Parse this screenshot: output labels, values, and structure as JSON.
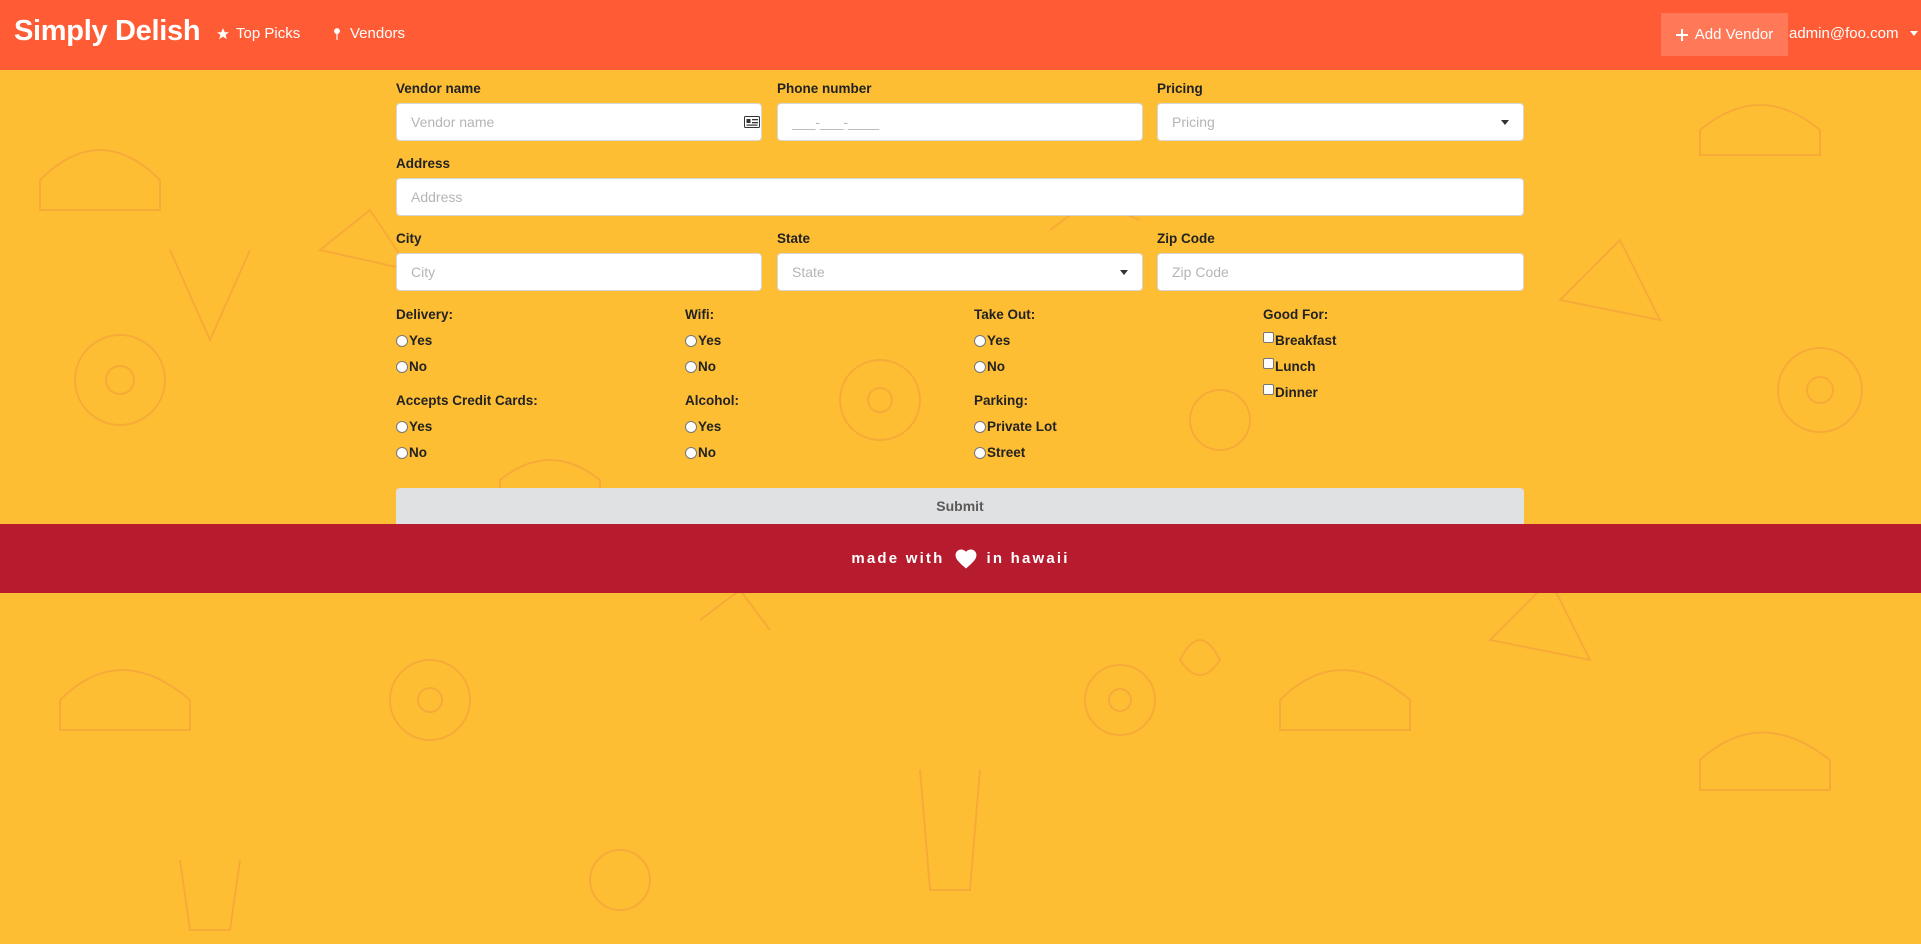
{
  "nav": {
    "brand": "Simply Delish",
    "items": [
      {
        "label": "Top Picks",
        "icon": "star-icon"
      },
      {
        "label": "Vendors",
        "icon": "pin-icon"
      }
    ],
    "add_vendor_label": "Add Vendor",
    "user_email": "admin@foo.com"
  },
  "form": {
    "vendor_name": {
      "label": "Vendor name",
      "placeholder": "Vendor name"
    },
    "phone": {
      "label": "Phone number",
      "placeholder": "___-___-____"
    },
    "pricing": {
      "label": "Pricing",
      "placeholder": "Pricing"
    },
    "address": {
      "label": "Address",
      "placeholder": "Address"
    },
    "city": {
      "label": "City",
      "placeholder": "City"
    },
    "state": {
      "label": "State",
      "placeholder": "State"
    },
    "zip": {
      "label": "Zip Code",
      "placeholder": "Zip Code"
    },
    "delivery": {
      "label": "Delivery:",
      "options": [
        "Yes",
        "No"
      ]
    },
    "wifi": {
      "label": "Wifi:",
      "options": [
        "Yes",
        "No"
      ]
    },
    "takeout": {
      "label": "Take Out:",
      "options": [
        "Yes",
        "No"
      ]
    },
    "good_for": {
      "label": "Good For:",
      "options": [
        "Breakfast",
        "Lunch",
        "Dinner"
      ]
    },
    "credit_cards": {
      "label": "Accepts Credit Cards:",
      "options": [
        "Yes",
        "No"
      ]
    },
    "alcohol": {
      "label": "Alcohol:",
      "options": [
        "Yes",
        "No"
      ]
    },
    "parking": {
      "label": "Parking:",
      "options": [
        "Private Lot",
        "Street"
      ]
    },
    "submit_label": "Submit"
  },
  "footer": {
    "text_before": "made with",
    "text_after": "in hawaii",
    "icon": "heart-icon"
  },
  "colors": {
    "navbar": "#ff5c35",
    "background": "#fdbe34",
    "footer": "#b71b2e"
  }
}
